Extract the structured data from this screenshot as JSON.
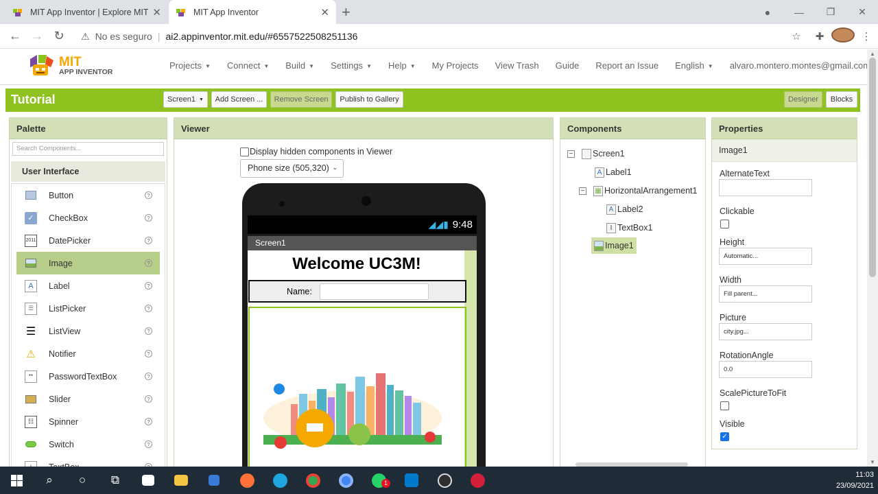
{
  "browser": {
    "tabs": [
      {
        "title": "MIT App Inventor | Explore MIT App Inventor",
        "active": false
      },
      {
        "title": "MIT App Inventor",
        "active": true
      }
    ],
    "security_label": "No es seguro",
    "url": "ai2.appinventor.mit.edu/#6557522508251136"
  },
  "header": {
    "logo_mit": "MIT",
    "logo_app": "APP INVENTOR",
    "menu": [
      "Projects",
      "Connect",
      "Build",
      "Settings",
      "Help",
      "My Projects",
      "View Trash",
      "Guide",
      "Report an Issue",
      "English",
      "alvaro.montero.montes@gmail.com"
    ]
  },
  "toolbar": {
    "project": "Tutorial",
    "screen_select": "Screen1",
    "add_screen": "Add Screen ...",
    "remove_screen": "Remove Screen",
    "publish": "Publish to Gallery",
    "designer": "Designer",
    "blocks": "Blocks"
  },
  "palette": {
    "title": "Palette",
    "search_placeholder": "Search Components...",
    "category": "User Interface",
    "items": [
      "Button",
      "CheckBox",
      "DatePicker",
      "Image",
      "Label",
      "ListPicker",
      "ListView",
      "Notifier",
      "PasswordTextBox",
      "Slider",
      "Spinner",
      "Switch",
      "TextBox"
    ],
    "selected": "Image"
  },
  "viewer": {
    "title": "Viewer",
    "hidden_label": "Display hidden components in Viewer",
    "phone_size": "Phone size (505,320)",
    "clock": "9:48",
    "screen_title": "Screen1",
    "welcome": "Welcome UC3M!",
    "name_label": "Name:"
  },
  "components": {
    "title": "Components",
    "tree": [
      "Screen1",
      "Label1",
      "HorizontalArrangement1",
      "Label2",
      "TextBox1",
      "Image1"
    ],
    "selected": "Image1"
  },
  "properties": {
    "title": "Properties",
    "component": "Image1",
    "fields": {
      "alternate_text": {
        "label": "AlternateText",
        "value": ""
      },
      "clickable": {
        "label": "Clickable",
        "checked": false
      },
      "height": {
        "label": "Height",
        "value": "Automatic..."
      },
      "width": {
        "label": "Width",
        "value": "Fill parent..."
      },
      "picture": {
        "label": "Picture",
        "value": "city.jpg..."
      },
      "rotation": {
        "label": "RotationAngle",
        "value": "0.0"
      },
      "scale": {
        "label": "ScalePictureToFit",
        "checked": false
      },
      "visible": {
        "label": "Visible",
        "checked": true
      }
    }
  },
  "taskbar": {
    "time": "11:03",
    "date": "23/09/2021",
    "whatsapp_badge": "1"
  },
  "colors": {
    "accent_green": "#8dc21f",
    "panel_header": "#d3e0b6",
    "logo_orange": "#f5a800"
  }
}
